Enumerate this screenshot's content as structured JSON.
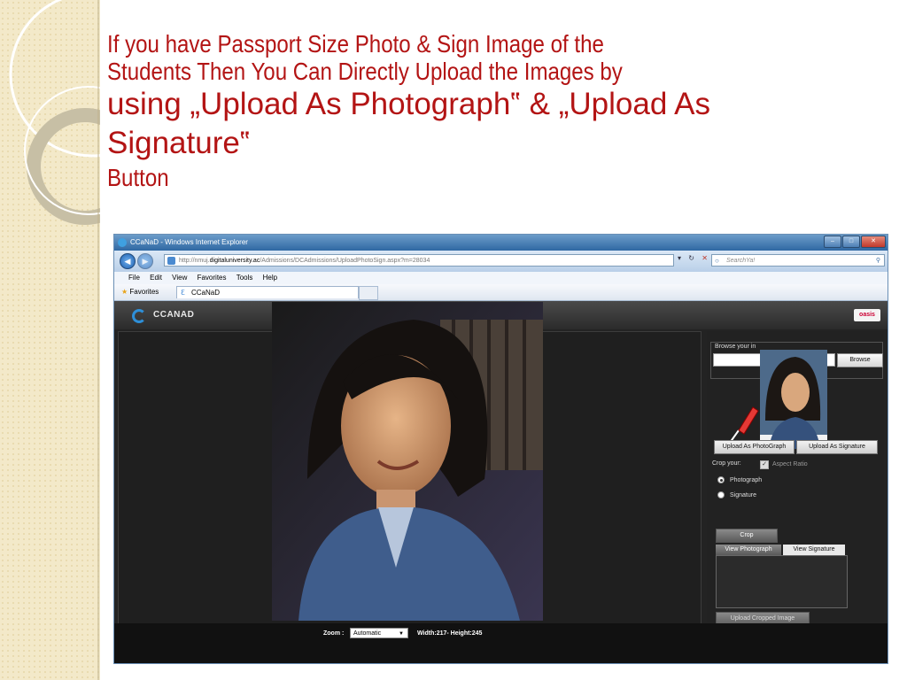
{
  "slide": {
    "title_line1": "If you have Passport Size Photo & Sign Image of the",
    "title_line2": "Students Then You Can Directly Upload the Images by",
    "title_line3": "using „Upload As Photograph‟ & „Upload As",
    "title_line4": "Signature‟",
    "title_line5": "Button"
  },
  "browser": {
    "window_title": "CCaNaD - Windows Internet Explorer",
    "url_prefix": "http://nmuj.",
    "url_domain": "digitaluniversity.ac",
    "url_path": "/Admissions/DCAdmissions/UploadPhotoSign.aspx?m=28034",
    "search_placeholder": "SearchYa!",
    "menu": [
      "File",
      "Edit",
      "View",
      "Favorites",
      "Tools",
      "Help"
    ],
    "favorites_label": "Favorites",
    "tab_label": "CCaNaD"
  },
  "app": {
    "logo": "CCANAD",
    "partner_logo": "oasis",
    "browse_label": "Browse your in",
    "browse_button": "Browse",
    "upload_photo_button": "Upload As PhotoGraph",
    "upload_sign_button": "Upload As Signature",
    "crop_label": "Crop your:",
    "aspect_ratio_label": "Aspect Ratio",
    "aspect_ratio_checked": true,
    "radio_photograph": "Photograph",
    "radio_signature": "Signature",
    "selected_radio": "Photograph",
    "crop_button": "Crop",
    "view_photo_tab": "View Photograph",
    "view_sign_tab": "View Signature",
    "upload_cropped_button": "Upload Cropped Image",
    "zoom_label": "Zoom :",
    "zoom_value": "Automatic",
    "dimensions": "Width:217- Height:245"
  },
  "colors": {
    "title_red": "#b31414",
    "app_dark": "#232323",
    "ie_blue": "#2f68a3"
  }
}
